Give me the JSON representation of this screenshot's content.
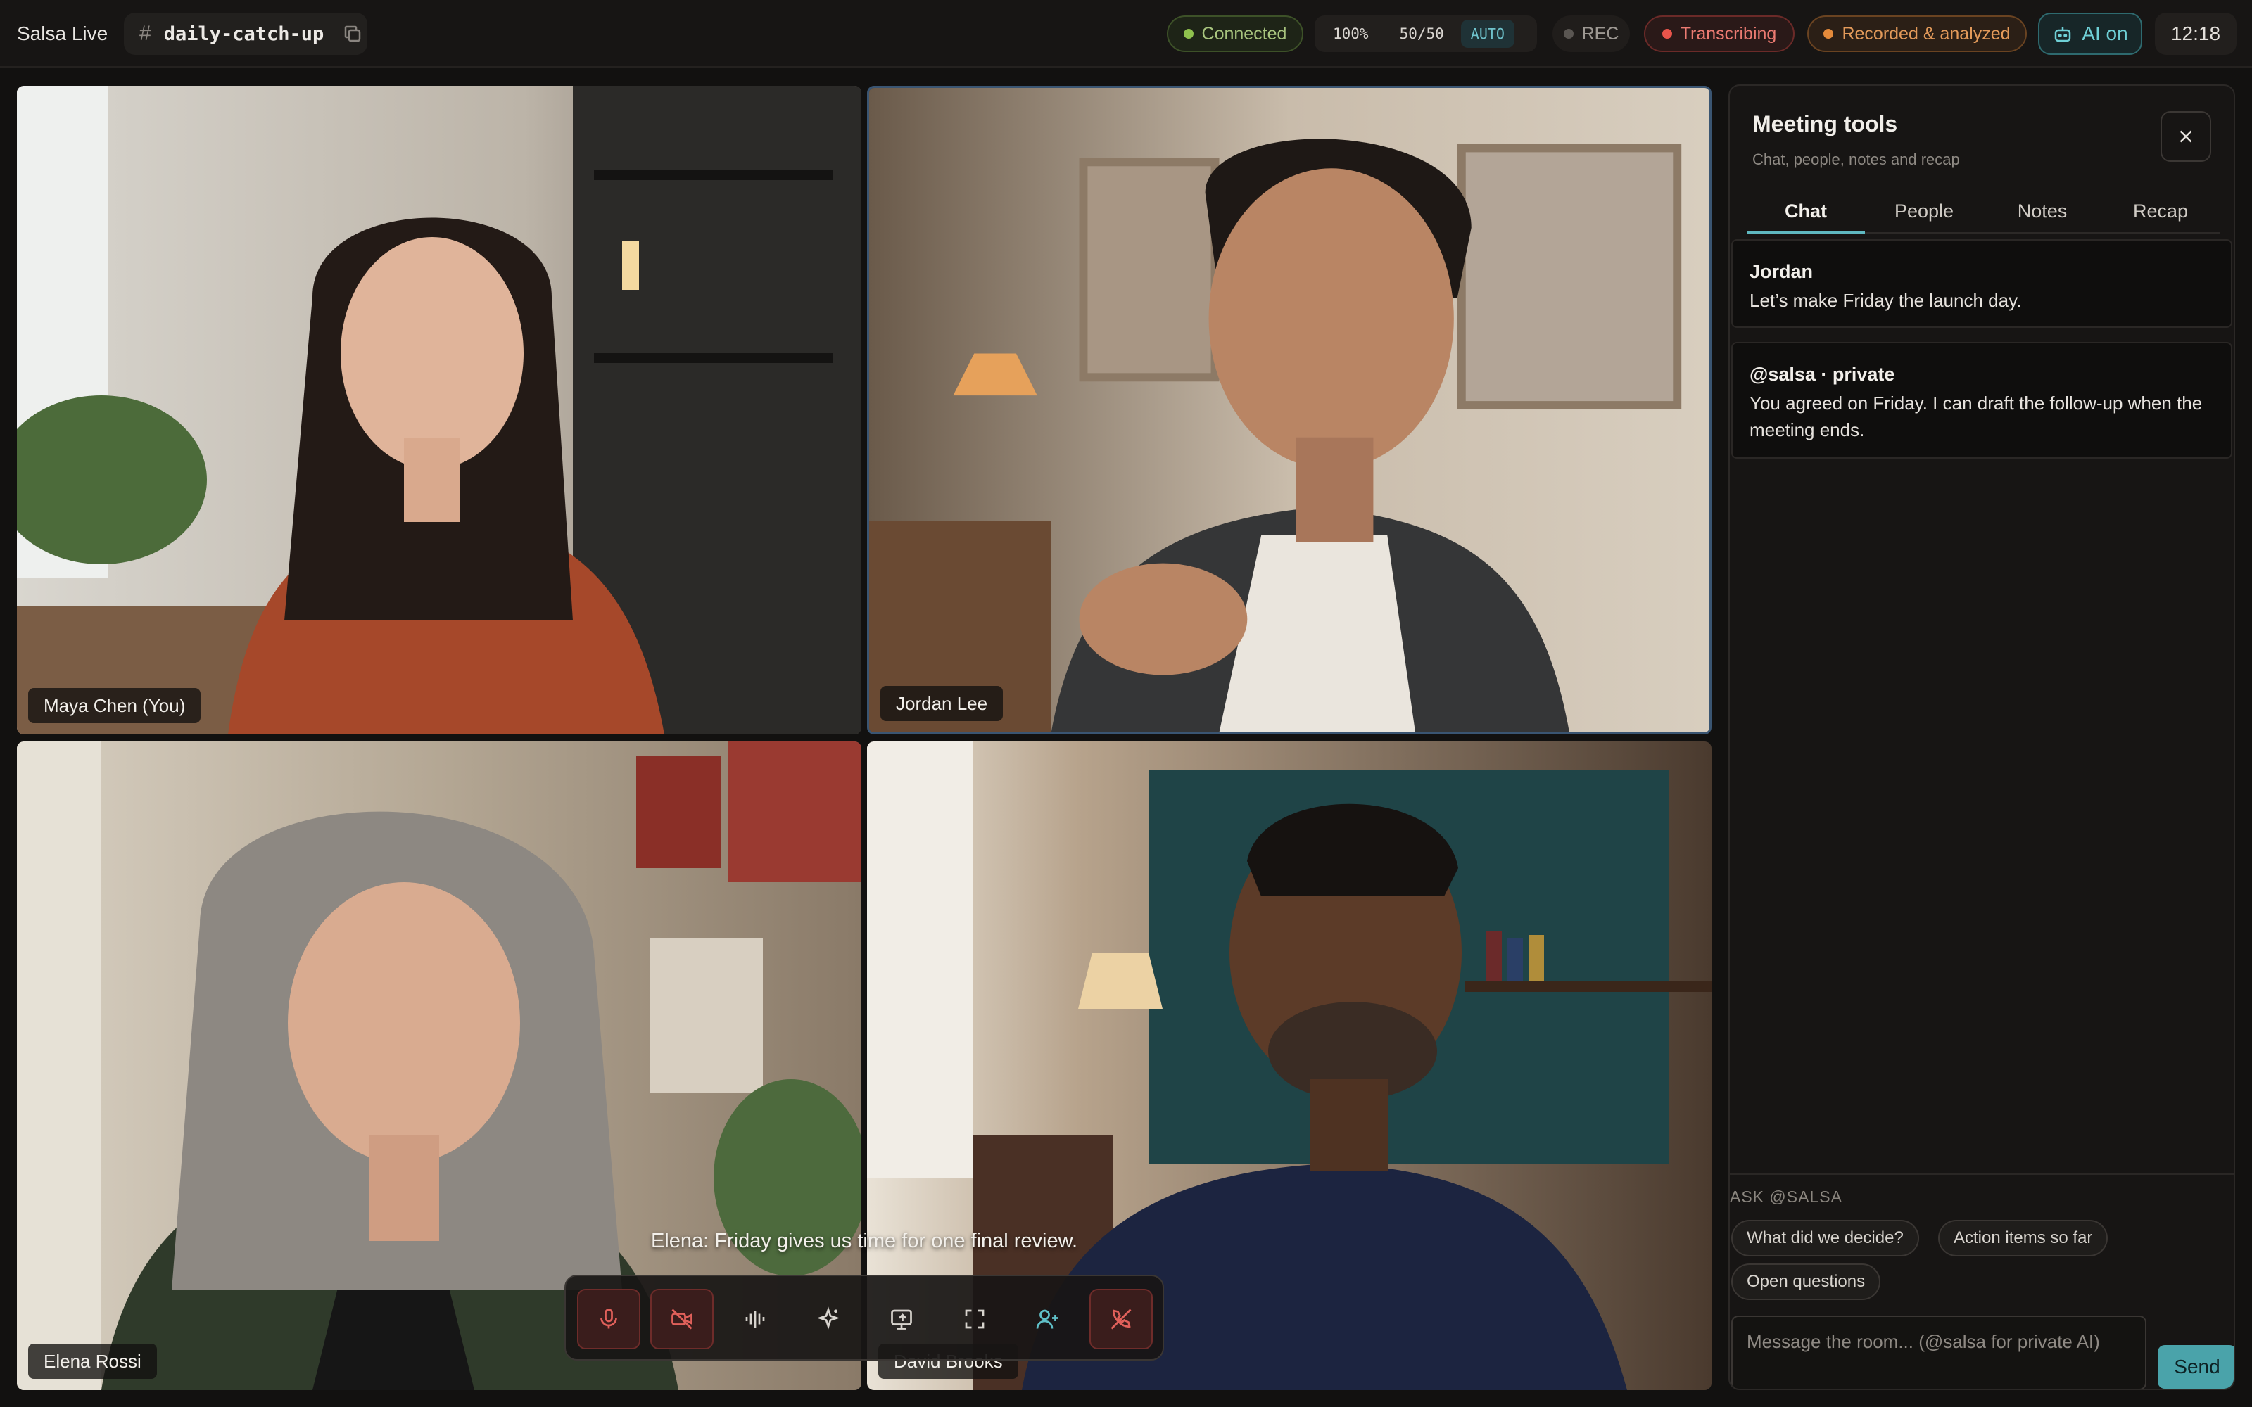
{
  "topbar": {
    "app_name": "Salsa Live",
    "room_name": "daily-catch-up",
    "status_connected": "Connected",
    "zoom": "100%",
    "split": "50/50",
    "mode": "AUTO",
    "rec_label": "REC",
    "transcribing_label": "Transcribing",
    "recorded_label": "Recorded & analyzed",
    "ai_label": "AI on",
    "clock": "12:18"
  },
  "participants": [
    {
      "name": "Maya Chen (You)"
    },
    {
      "name": "Jordan Lee"
    },
    {
      "name": "Elena Rossi"
    },
    {
      "name": "David Brooks"
    }
  ],
  "caption": "Elena: Friday gives us time for one final review.",
  "controls": {
    "icons": [
      "mic-icon",
      "camera-off-icon",
      "waveform-icon",
      "sparkle-icon",
      "screen-share-icon",
      "fullscreen-icon",
      "add-person-icon",
      "hang-up-icon"
    ]
  },
  "panel": {
    "title": "Meeting tools",
    "subtitle": "Chat, people, notes and recap",
    "tabs": [
      {
        "label": "Chat"
      },
      {
        "label": "People"
      },
      {
        "label": "Notes"
      },
      {
        "label": "Recap"
      }
    ],
    "messages": [
      {
        "author": "Jordan",
        "text": "Let’s make Friday the launch day."
      },
      {
        "author": "@salsa · private",
        "text": "You agreed on Friday. I can draft the follow-up when the meeting ends."
      }
    ],
    "ask_label": "ASK @SALSA",
    "suggestions": [
      "What did we decide?",
      "Action items so far",
      "Open questions"
    ],
    "input_placeholder": "Message the room... (@salsa for private AI)",
    "send_label": "Send"
  },
  "colors": {
    "accent": "#4aa3aa",
    "connected": "#8fc14d",
    "transcribing": "#e8544b",
    "recorded": "#e48a3b"
  }
}
